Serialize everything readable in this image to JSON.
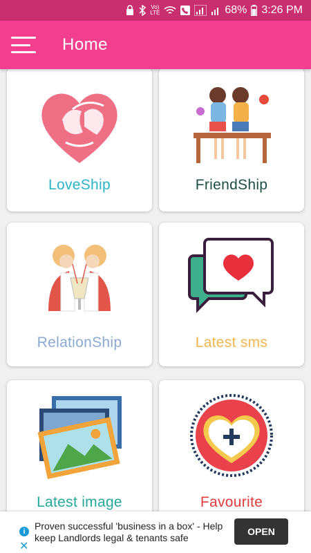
{
  "status_bar": {
    "battery": "68%",
    "time": "3:26 PM",
    "network": "LTE"
  },
  "app_bar": {
    "title": "Home"
  },
  "cards": [
    {
      "label": "LoveShip",
      "color": "#2bb3c8"
    },
    {
      "label": "FriendShip",
      "color": "#1e4d45"
    },
    {
      "label": "RelationShip",
      "color": "#8aa9d1"
    },
    {
      "label": "Latest sms",
      "color": "#f0b64d"
    },
    {
      "label": "Latest image",
      "color": "#24a89a"
    },
    {
      "label": "Favourite",
      "color": "#e03c3c"
    }
  ],
  "ad": {
    "text": "Proven successful 'business in a box' - Help keep Landlords legal & tenants safe",
    "button": "OPEN"
  },
  "colors": {
    "status_bar": "#c92f6e",
    "app_bar": "#f43f8f"
  }
}
